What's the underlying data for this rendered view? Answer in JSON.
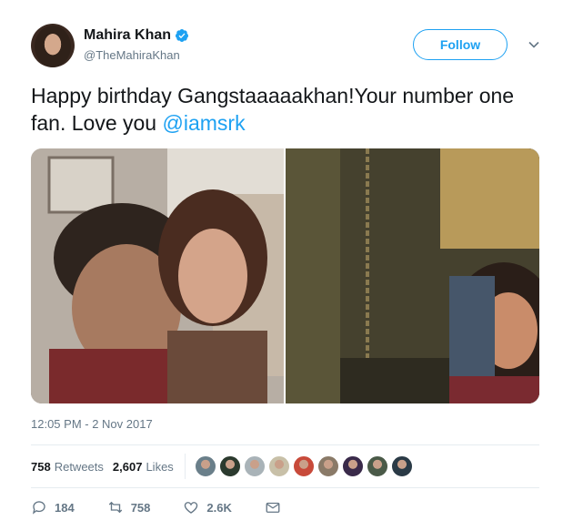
{
  "author": {
    "display_name": "Mahira Khan",
    "handle": "@TheMahiraKhan",
    "verified_icon": "verified-badge-icon",
    "avatar_icon": "profile-photo"
  },
  "header": {
    "follow_label": "Follow",
    "menu_icon": "chevron-down-icon"
  },
  "tweet": {
    "text": "Happy birthday Gangstaaaaakhan!Your number one fan. Love you ",
    "mention": "@iamsrk"
  },
  "media": {
    "photos": [
      {
        "description_icon": "photo-left"
      },
      {
        "description_icon": "photo-right"
      }
    ]
  },
  "timestamp": "12:05 PM - 2 Nov 2017",
  "stats": {
    "retweets_count": "758",
    "retweets_label": "Retweets",
    "likes_count": "2,607",
    "likes_label": "Likes",
    "liker_colors": [
      "#6a7f8a",
      "#2b3a2e",
      "#a9b3b8",
      "#c8c0a8",
      "#c84a3a",
      "#8a7a68",
      "#3a2a4a",
      "#4a5a48",
      "#2a3a46"
    ]
  },
  "actions": {
    "reply_count": "184",
    "retweet_count": "758",
    "like_count": "2.6K",
    "reply_icon": "reply-icon",
    "retweet_icon": "retweet-icon",
    "like_icon": "heart-icon",
    "dm_icon": "envelope-icon"
  },
  "colors": {
    "accent": "#1da1f2",
    "text": "#14171a",
    "muted": "#657786"
  }
}
